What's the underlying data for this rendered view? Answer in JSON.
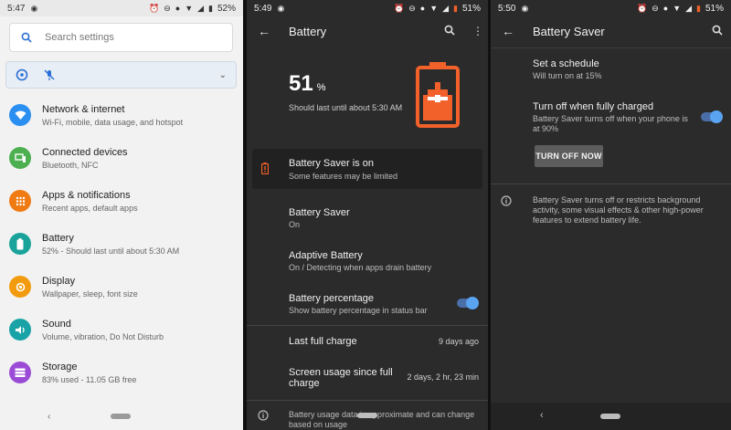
{
  "panel1": {
    "status": {
      "time": "5:47",
      "battery": "52%"
    },
    "search": {
      "placeholder": "Search settings"
    },
    "items": [
      {
        "title": "Network & internet",
        "sub": "Wi-Fi, mobile, data usage, and hotspot",
        "icon": "wifi-icon",
        "color": "#2a8ff0"
      },
      {
        "title": "Connected devices",
        "sub": "Bluetooth, NFC",
        "icon": "devices-icon",
        "color": "#4caf50"
      },
      {
        "title": "Apps & notifications",
        "sub": "Recent apps, default apps",
        "icon": "apps-icon",
        "color": "#ef7b12"
      },
      {
        "title": "Battery",
        "sub": "52% - Should last until about 5:30 AM",
        "icon": "battery-icon",
        "color": "#1aa39a"
      },
      {
        "title": "Display",
        "sub": "Wallpaper, sleep, font size",
        "icon": "display-icon",
        "color": "#f29b0e"
      },
      {
        "title": "Sound",
        "sub": "Volume, vibration, Do Not Disturb",
        "icon": "sound-icon",
        "color": "#19a3a6"
      },
      {
        "title": "Storage",
        "sub": "83% used - 11.05 GB free",
        "icon": "storage-icon",
        "color": "#9b4cd6"
      }
    ]
  },
  "panel2": {
    "status": {
      "time": "5:49",
      "battery": "51%"
    },
    "title": "Battery",
    "level": {
      "value": "51",
      "unit": "%",
      "note": "Should last until about 5:30 AM"
    },
    "saver_banner": {
      "title": "Battery Saver is on",
      "sub": "Some features may be limited"
    },
    "rows": [
      {
        "title": "Battery Saver",
        "sub": "On"
      },
      {
        "title": "Adaptive Battery",
        "sub": "On / Detecting when apps drain battery"
      },
      {
        "title": "Battery percentage",
        "sub": "Show battery percentage in status bar"
      }
    ],
    "last_full_charge": {
      "label": "Last full charge",
      "value": "9 days ago"
    },
    "screen_usage": {
      "label": "Screen usage since full charge",
      "value": "2 days, 2 hr, 23 min"
    },
    "footer": "Battery usage data is approximate and can change based on usage"
  },
  "panel3": {
    "status": {
      "time": "5:50",
      "battery": "51%"
    },
    "title": "Battery Saver",
    "schedule": {
      "title": "Set a schedule",
      "sub": "Will turn on at 15%"
    },
    "turn_off": {
      "title": "Turn off when fully charged",
      "sub": "Battery Saver turns off when your phone is at 90%"
    },
    "button": "TURN OFF NOW",
    "info": "Battery Saver turns off or restricts background activity, some visual effects & other high-power features to extend battery life."
  },
  "colors": {
    "accent_toggle": "#5aa3f0",
    "battery_orange": "#f2612a"
  }
}
